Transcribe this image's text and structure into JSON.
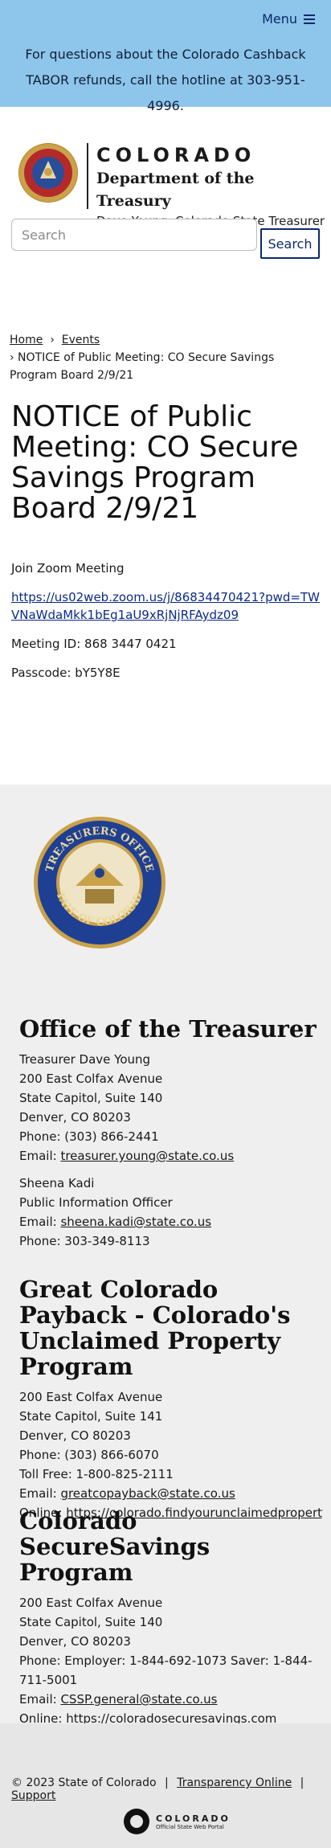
{
  "menu": {
    "label": "Menu",
    "icon": "hamburger-icon"
  },
  "alert": {
    "text": "For questions about the Colorado Cashback TABOR refunds, call the hotline at 303-951-4996."
  },
  "brand": {
    "state": "COLORADO",
    "department": "Department of the Treasury",
    "subtitle": "Dave Young, Colorado State Treasurer"
  },
  "search": {
    "placeholder": "Search",
    "button": "Search"
  },
  "breadcrumb": {
    "home": "Home",
    "events": "Events",
    "current": "› NOTICE of Public Meeting: CO Secure Savings Program Board 2/9/21"
  },
  "article": {
    "title": "NOTICE of Public Meeting: CO Secure Savings Program Board 2/9/21",
    "join": "Join Zoom Meeting",
    "zoom_link": "https://us02web.zoom.us/j/86834470421?pwd=TWVNaWdaMkk1bEg1aU9xRjNjRFAydz09",
    "meeting_id": "Meeting ID: 868 3447 0421",
    "passcode": "Passcode: bY5Y8E"
  },
  "footer": {
    "seal_text": "TREASURERS OFFICE · STATE OF COLORADO",
    "treasurer": {
      "heading": "Office of the Treasurer",
      "lines": [
        "Treasurer Dave Young",
        "200 East Colfax Avenue",
        "State Capitol, Suite 140",
        "Denver, CO 80203",
        "Phone: (303) 866-2441"
      ],
      "email_label": "Email: ",
      "email": "treasurer.young@state.co.us",
      "contact_name": "Sheena Kadi",
      "contact_title": "Public Information Officer",
      "contact_email_label": "Email: ",
      "contact_email": "sheena.kadi@state.co.us",
      "contact_phone": "Phone: 303-349-8113"
    },
    "payback": {
      "heading": "Great Colorado Payback - Colorado's Unclaimed Property Program",
      "lines": [
        "200 East Colfax Avenue",
        "State Capitol, Suite 141",
        "Denver, CO 80203",
        "Phone: (303) 866-6070",
        "Toll Free:  1-800-825-2111"
      ],
      "email_label": "Email: ",
      "email": "greatcopayback@state.co.us",
      "online_label": "Online: ",
      "online": "https://colorado.findyourunclaimedproperty.com"
    },
    "securesavings": {
      "heading": "Colorado SecureSavings Program",
      "lines": [
        "200 East Colfax Avenue",
        "State Capitol, Suite 140",
        "Denver, CO 80203"
      ],
      "phone": "Phone: Employer: 1-844-692-1073  Saver: 1-844-711-5001",
      "email_label": "Email: ",
      "email": "CSSP.general@state.co.us",
      "online_label": "Online: ",
      "online": "https://coloradosecuresavings.com"
    }
  },
  "bottom": {
    "copyright": "© 2023 State of Colorado",
    "sep": "|",
    "transparency": "Transparency Online",
    "support": "Support",
    "portal_title": "COLORADO",
    "portal_subtitle": "Official State Web Portal"
  },
  "colors": {
    "banner": "#8ec5ea",
    "navy": "#0b2a6b",
    "footer": "#efefef"
  }
}
